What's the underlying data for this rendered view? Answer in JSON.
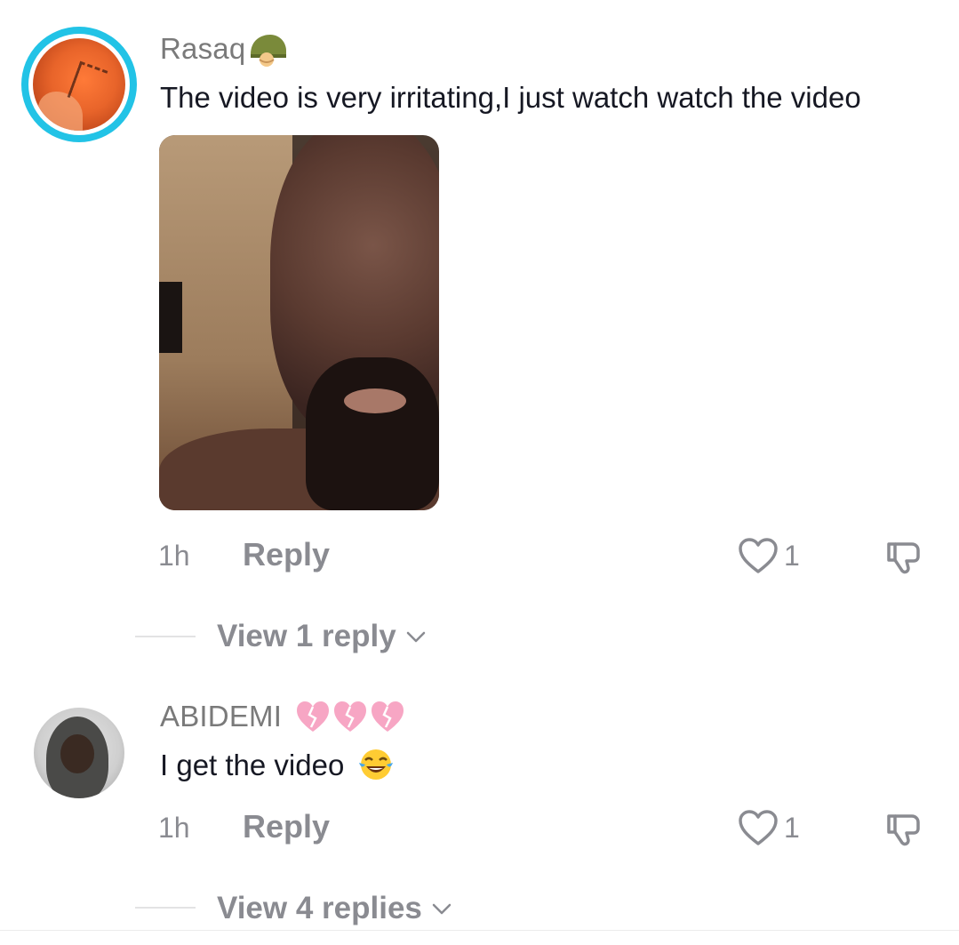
{
  "comments": [
    {
      "username": "Rasaq",
      "username_emoji": "military-helmet",
      "text": "The video is very irritating,I just watch watch the video",
      "has_media": true,
      "time": "1h",
      "reply_label": "Reply",
      "like_count": "1",
      "view_replies": "View 1 reply"
    },
    {
      "username": "ABIDEMI",
      "username_emoji": "broken-hearts",
      "text": "I get the video",
      "text_emoji": "face-with-tears-of-joy",
      "time": "1h",
      "reply_label": "Reply",
      "like_count": "1",
      "view_replies": "View 4 replies"
    }
  ],
  "colors": {
    "avatar_ring": "#22c3e6",
    "secondary_text": "#8a8b91",
    "primary_text": "#161823"
  }
}
